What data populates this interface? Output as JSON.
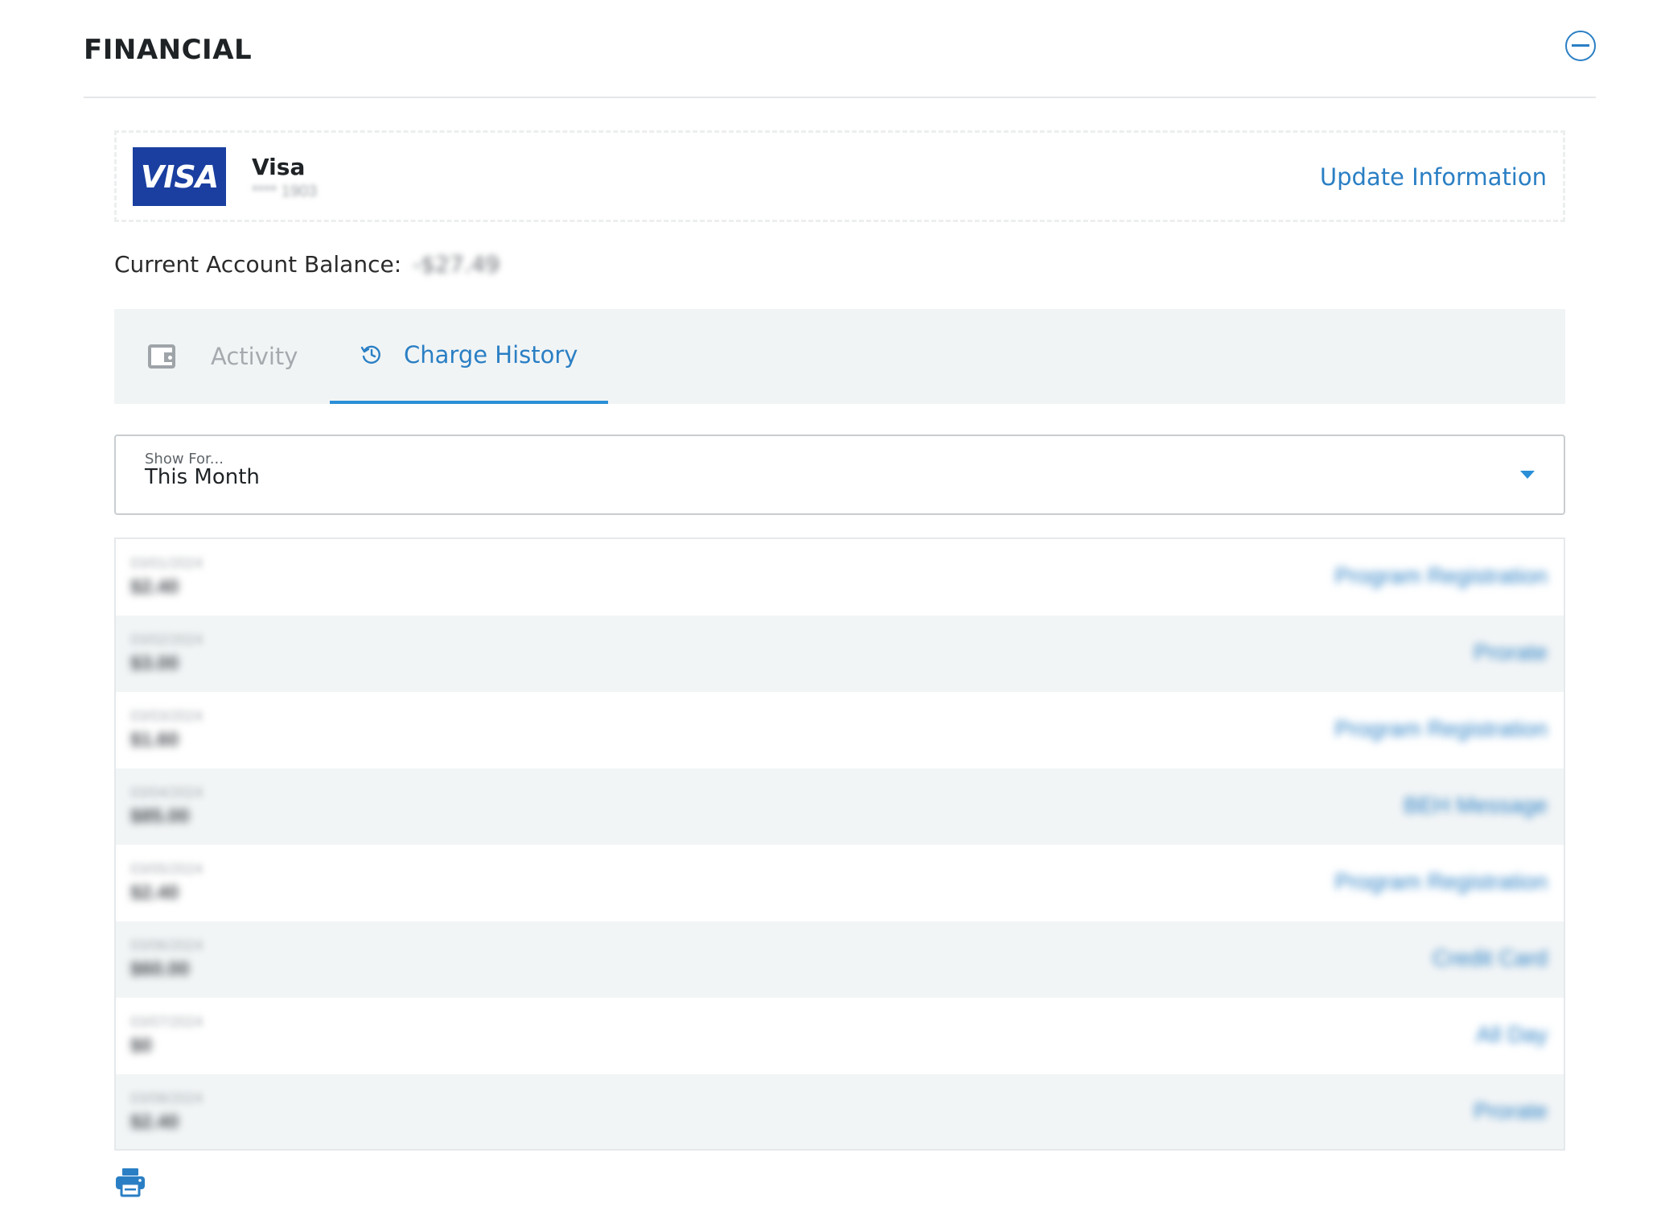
{
  "section": {
    "title": "FINANCIAL"
  },
  "card": {
    "brand_logo_text": "VISA",
    "name": "Visa",
    "masked_number": "**** 1903",
    "update_link": "Update Information"
  },
  "balance": {
    "label": "Current Account Balance:",
    "value": "-$27.49"
  },
  "tabs": [
    {
      "label": "Activity",
      "icon": "wallet-icon",
      "active": false
    },
    {
      "label": "Charge History",
      "icon": "history-icon",
      "active": true
    }
  ],
  "filter": {
    "label": "Show For...",
    "value": "This Month"
  },
  "history": [
    {
      "date": "03/01/2024",
      "amount": "$2.40",
      "description": "Program Registration"
    },
    {
      "date": "03/02/2024",
      "amount": "$3.00",
      "description": "Prorate"
    },
    {
      "date": "03/03/2024",
      "amount": "$1.60",
      "description": "Program Registration"
    },
    {
      "date": "03/04/2024",
      "amount": "$85.00",
      "description": "BEH Message"
    },
    {
      "date": "03/05/2024",
      "amount": "$2.40",
      "description": "Program Registration"
    },
    {
      "date": "03/06/2024",
      "amount": "$60.00",
      "description": "Credit Card"
    },
    {
      "date": "03/07/2024",
      "amount": "$0",
      "description": "All Day"
    },
    {
      "date": "03/08/2024",
      "amount": "$2.40",
      "description": "Prorate"
    }
  ],
  "colors": {
    "accent": "#2a7fc4",
    "visa_blue": "#1a3fa0",
    "tab_bar_bg": "#f1f4f5"
  }
}
